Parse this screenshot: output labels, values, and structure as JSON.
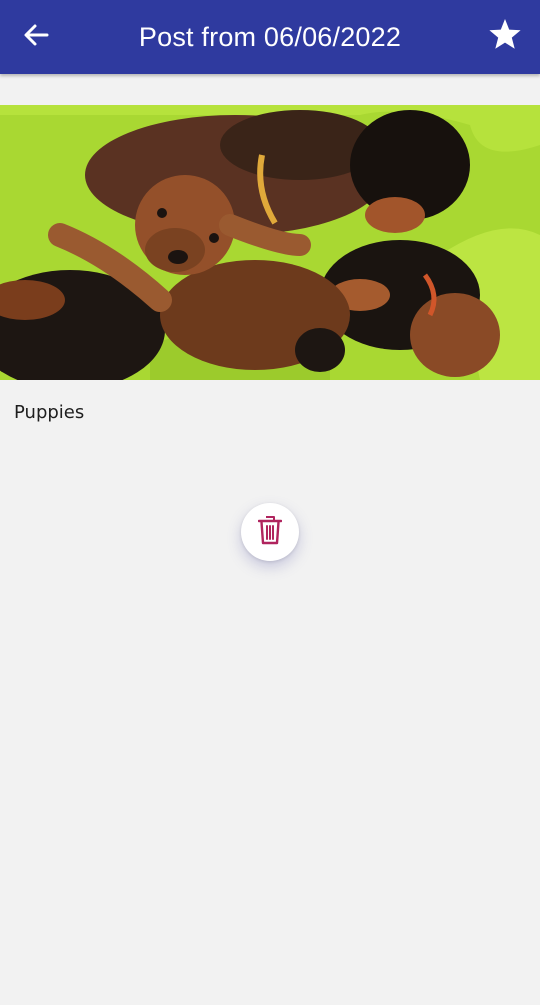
{
  "header": {
    "title": "Post from 06/06/2022",
    "back_icon": "arrow-left-icon",
    "favorite_icon": "star-icon",
    "background_color": "#2f3a9f"
  },
  "post": {
    "image_description_name": "puppies-photo",
    "caption": "Puppies"
  },
  "actions": {
    "delete_icon": "trash-icon",
    "delete_icon_color": "#b0245e"
  }
}
